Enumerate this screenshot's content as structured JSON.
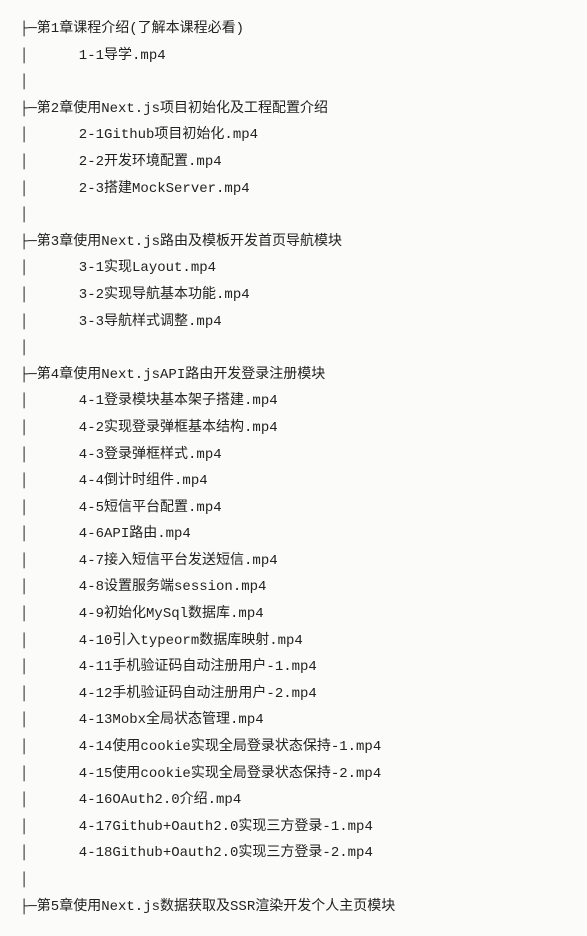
{
  "tree": [
    {
      "type": "chapter",
      "text": "├─第1章课程介绍(了解本课程必看)"
    },
    {
      "type": "file",
      "text": "│      1-1导学.mp4"
    },
    {
      "type": "blank",
      "text": "│"
    },
    {
      "type": "chapter",
      "text": "├─第2章使用Next.js项目初始化及工程配置介绍"
    },
    {
      "type": "file",
      "text": "│      2-1Github项目初始化.mp4"
    },
    {
      "type": "file",
      "text": "│      2-2开发环境配置.mp4"
    },
    {
      "type": "file",
      "text": "│      2-3搭建MockServer.mp4"
    },
    {
      "type": "blank",
      "text": "│"
    },
    {
      "type": "chapter",
      "text": "├─第3章使用Next.js路由及模板开发首页导航模块"
    },
    {
      "type": "file",
      "text": "│      3-1实现Layout.mp4"
    },
    {
      "type": "file",
      "text": "│      3-2实现导航基本功能.mp4"
    },
    {
      "type": "file",
      "text": "│      3-3导航样式调整.mp4"
    },
    {
      "type": "blank",
      "text": "│"
    },
    {
      "type": "chapter",
      "text": "├─第4章使用Next.jsAPI路由开发登录注册模块"
    },
    {
      "type": "file",
      "text": "│      4-1登录模块基本架子搭建.mp4"
    },
    {
      "type": "file",
      "text": "│      4-2实现登录弹框基本结构.mp4"
    },
    {
      "type": "file",
      "text": "│      4-3登录弹框样式.mp4"
    },
    {
      "type": "file",
      "text": "│      4-4倒计时组件.mp4"
    },
    {
      "type": "file",
      "text": "│      4-5短信平台配置.mp4"
    },
    {
      "type": "file",
      "text": "│      4-6API路由.mp4"
    },
    {
      "type": "file",
      "text": "│      4-7接入短信平台发送短信.mp4"
    },
    {
      "type": "file",
      "text": "│      4-8设置服务端session.mp4"
    },
    {
      "type": "file",
      "text": "│      4-9初始化MySql数据库.mp4"
    },
    {
      "type": "file",
      "text": "│      4-10引入typeorm数据库映射.mp4"
    },
    {
      "type": "file",
      "text": "│      4-11手机验证码自动注册用户-1.mp4"
    },
    {
      "type": "file",
      "text": "│      4-12手机验证码自动注册用户-2.mp4"
    },
    {
      "type": "file",
      "text": "│      4-13Mobx全局状态管理.mp4"
    },
    {
      "type": "file",
      "text": "│      4-14使用cookie实现全局登录状态保持-1.mp4"
    },
    {
      "type": "file",
      "text": "│      4-15使用cookie实现全局登录状态保持-2.mp4"
    },
    {
      "type": "file",
      "text": "│      4-16OAuth2.0介绍.mp4"
    },
    {
      "type": "file",
      "text": "│      4-17Github+Oauth2.0实现三方登录-1.mp4"
    },
    {
      "type": "file",
      "text": "│      4-18Github+Oauth2.0实现三方登录-2.mp4"
    },
    {
      "type": "blank",
      "text": "│"
    },
    {
      "type": "chapter",
      "text": "├─第5章使用Next.js数据获取及SSR渲染开发个人主页模块"
    }
  ]
}
